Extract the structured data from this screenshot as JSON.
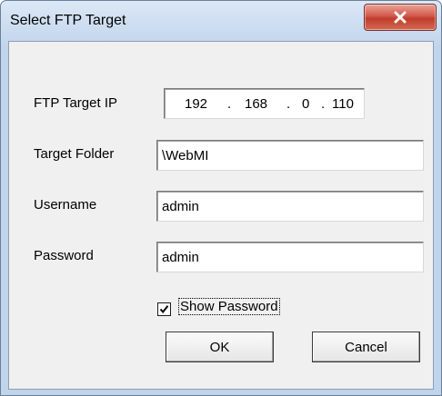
{
  "window": {
    "title": "Select FTP Target",
    "close_icon": "close-x-icon"
  },
  "form": {
    "ip_label": "FTP Target IP",
    "ip": [
      "192",
      "168",
      "0",
      "110"
    ],
    "ip_separator": ".",
    "folder_label": "Target Folder",
    "folder_value": "\\WebMI",
    "username_label": "Username",
    "username_value": "admin",
    "password_label": "Password",
    "password_value": "admin",
    "show_password_label": "Show Password",
    "show_password_checked": true
  },
  "buttons": {
    "ok": "OK",
    "cancel": "Cancel"
  }
}
